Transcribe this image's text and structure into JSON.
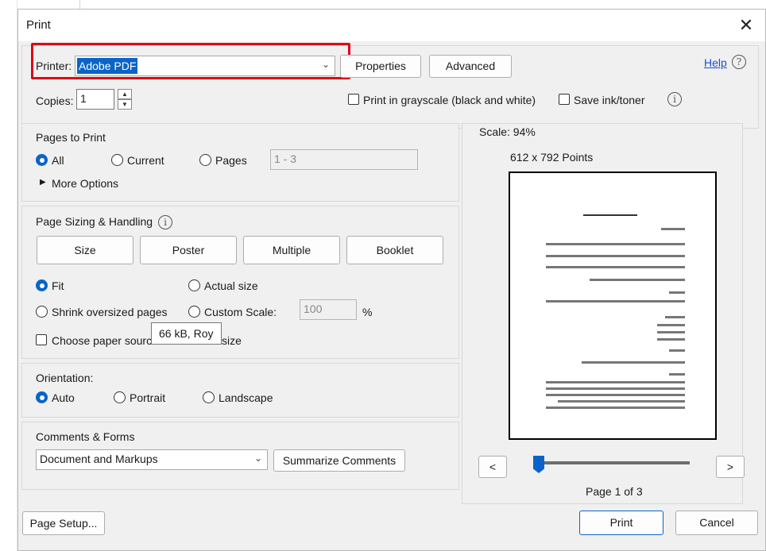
{
  "dialog": {
    "title": "Print",
    "close_glyph": "✕"
  },
  "printer": {
    "label": "Printer:",
    "value": "Adobe PDF",
    "properties_label": "Properties",
    "advanced_label": "Advanced",
    "help_label": "Help"
  },
  "copies": {
    "label": "Copies:",
    "value": "1"
  },
  "options": {
    "grayscale_label": "Print in grayscale (black and white)",
    "save_ink_label": "Save ink/toner"
  },
  "pages_to_print": {
    "heading": "Pages to Print",
    "all_label": "All",
    "current_label": "Current",
    "pages_label": "Pages",
    "pages_range_value": "1 - 3",
    "selected": "All",
    "more_options_label": "More Options"
  },
  "page_sizing": {
    "heading": "Page Sizing & Handling",
    "buttons": {
      "size": "Size",
      "poster": "Poster",
      "multiple": "Multiple",
      "booklet": "Booklet"
    },
    "fit_label": "Fit",
    "actual_size_label": "Actual size",
    "shrink_label": "Shrink oversized pages",
    "custom_scale_label": "Custom Scale:",
    "custom_scale_value": "100",
    "percent": "%",
    "paper_source_label": "Choose paper source",
    "paper_source_tail": "size",
    "selected": "Fit"
  },
  "tooltip": {
    "text": "66 kB, Roy"
  },
  "orientation": {
    "heading": "Orientation:",
    "auto_label": "Auto",
    "portrait_label": "Portrait",
    "landscape_label": "Landscape",
    "selected": "Auto"
  },
  "comments": {
    "heading": "Comments & Forms",
    "value": "Document and Markups",
    "summarize_label": "Summarize Comments"
  },
  "preview": {
    "scale_text": "Scale:  94%",
    "dimensions_text": "612 x 792 Points",
    "page_indicator": "Page 1 of 3",
    "prev_glyph": "<",
    "next_glyph": ">",
    "slider_position": 0
  },
  "footer": {
    "page_setup_label": "Page Setup...",
    "print_label": "Print",
    "cancel_label": "Cancel"
  },
  "colors": {
    "accent": "#0a64c8",
    "highlight_box": "#e0001b",
    "link": "#1a4fd6"
  }
}
